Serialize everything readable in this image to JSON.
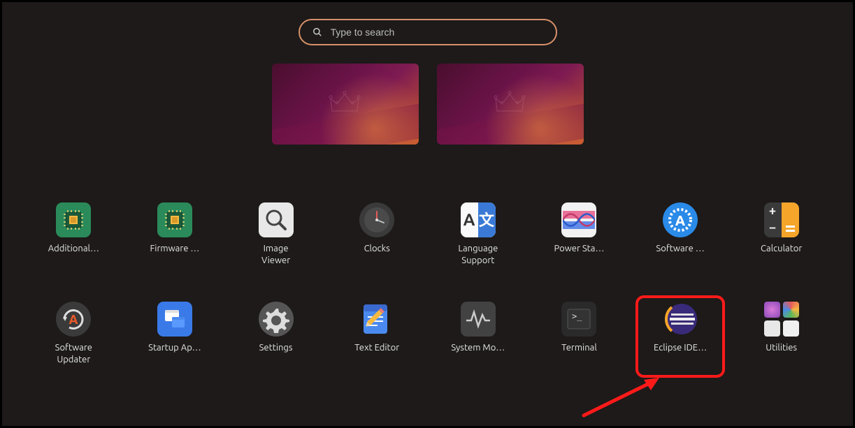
{
  "search": {
    "placeholder": "Type to search"
  },
  "apps": {
    "additional_drivers": "Additional…",
    "firmware": "Firmware …",
    "image_viewer": "Image\nViewer",
    "clocks": "Clocks",
    "language": "Language\nSupport",
    "power_stats": "Power Sta…",
    "software": "Software …",
    "calculator": "Calculator",
    "software_updater": "Software\nUpdater",
    "startup": "Startup Ap…",
    "settings": "Settings",
    "text_editor": "Text Editor",
    "system_monitor": "System Mo…",
    "terminal": "Terminal",
    "eclipse": "Eclipse IDE…",
    "utilities": "Utilities"
  }
}
